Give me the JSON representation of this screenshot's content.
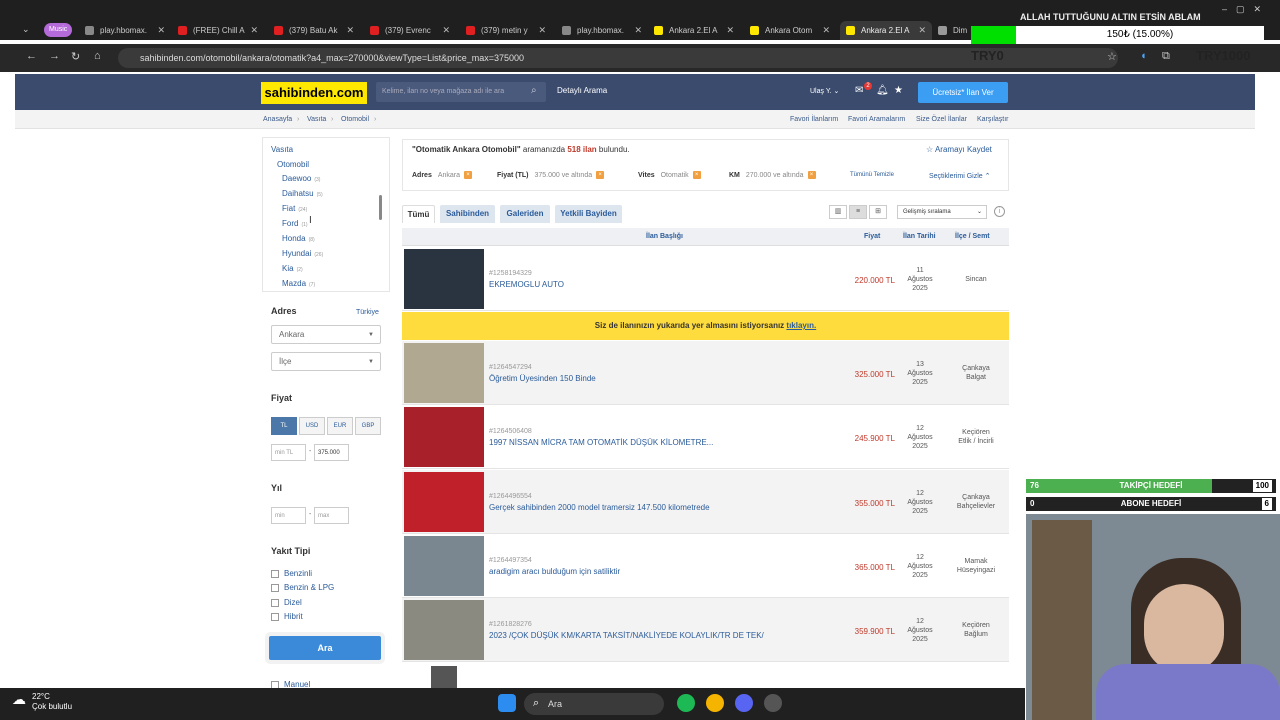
{
  "browser": {
    "tabs": [
      {
        "label": "play.hbomax.",
        "color": "#888"
      },
      {
        "label": "(FREE) Chill A",
        "color": "#e02020"
      },
      {
        "label": "(379) Batu Ak",
        "color": "#e02020"
      },
      {
        "label": "(379) Evrenc",
        "color": "#e02020"
      },
      {
        "label": "(379) metin y",
        "color": "#e02020"
      },
      {
        "label": "play.hbomax.",
        "color": "#888"
      },
      {
        "label": "Ankara 2.El A",
        "color": "#ffe800"
      },
      {
        "label": "Ankara Otom",
        "color": "#ffe800"
      },
      {
        "label": "Ankara 2.El A",
        "color": "#ffe800"
      },
      {
        "label": "Dim",
        "color": "#999"
      }
    ],
    "group_label": "Music",
    "url": "sahibinden.com/otomobil/ankara/otomatik?a4_max=270000&viewType=List&price_max=375000"
  },
  "site": {
    "logo": "sahibinden.com",
    "search_placeholder": "Kelime, ilan no veya mağaza adı ile ara",
    "detayli_arama": "Detaylı Arama",
    "user": "Ulaş Y.",
    "ilan_ver": "Ücretsiz* İlan Ver",
    "notif_count": "2"
  },
  "breadcrumb": [
    "Anasayfa",
    "Vasıta",
    "Otomobil"
  ],
  "top_links": [
    "Favori İlanlarım",
    "Favori Aramalarım",
    "Size Özel İlanlar",
    "Karşılaştır"
  ],
  "sidebar": {
    "root": "Vasıta",
    "sub": "Otomobil",
    "brands": [
      {
        "name": "Daewoo",
        "count": "(3)"
      },
      {
        "name": "Daihatsu",
        "count": "(5)"
      },
      {
        "name": "Fiat",
        "count": "(24)"
      },
      {
        "name": "Ford",
        "count": "(1)"
      },
      {
        "name": "Honda",
        "count": "(8)"
      },
      {
        "name": "Hyundai",
        "count": "(26)"
      },
      {
        "name": "Kia",
        "count": "(2)"
      },
      {
        "name": "Mazda",
        "count": "(7)"
      }
    ],
    "adres_title": "Adres",
    "adres_link": "Türkiye",
    "il": "Ankara",
    "ilce": "İlçe",
    "fiyat_title": "Fiyat",
    "currencies": [
      "TL",
      "USD",
      "EUR",
      "GBP"
    ],
    "price_min_ph": "min TL",
    "price_max": "375.000",
    "yil_title": "Yıl",
    "yil_min_ph": "min",
    "yil_max_ph": "max",
    "yakit_title": "Yakıt Tipi",
    "yakit": [
      "Benzinli",
      "Benzin & LPG",
      "Dizel",
      "Hibrit"
    ],
    "vites_partial": "Manuel",
    "ara": "Ara"
  },
  "results": {
    "query": "\"Otomatik Ankara Otomobil\"",
    "mid": " aramanızda ",
    "count": "518 ilan",
    "tail": " bulundu.",
    "save_search": "Aramayı Kaydet",
    "filters": [
      {
        "key": "Adres",
        "val": "Ankara"
      },
      {
        "key": "Fiyat (TL)",
        "val": "375.000 ve altında"
      },
      {
        "key": "Vites",
        "val": "Otomatik"
      },
      {
        "key": "KM",
        "val": "270.000 ve altında"
      }
    ],
    "clear_all": "Tümünü Temizle",
    "hide_selected": "Seçtiklerimi Gizle",
    "tabs": [
      "Tümü",
      "Sahibinden",
      "Galeriden",
      "Yetkili Bayiden"
    ],
    "sort": "Gelişmiş sıralama",
    "columns": [
      "İlan Başlığı",
      "Fiyat",
      "İlan Tarihi",
      "İlçe / Semt"
    ],
    "promo_text": "Siz de ilanınızın yukarıda yer almasını istiyorsanız ",
    "promo_link": "tıklayın.",
    "rows": [
      {
        "id": "#1258194329",
        "title": "EKREMOGLU AUTO",
        "price": "220.000 TL",
        "d1": "11",
        "d2": "Ağustos",
        "d3": "2025",
        "l1": "Sincan",
        "l2": ""
      },
      {
        "id": "#1264547294",
        "title": "Öğretim Üyesinden 150 Binde",
        "price": "325.000 TL",
        "d1": "13",
        "d2": "Ağustos",
        "d3": "2025",
        "l1": "Çankaya",
        "l2": "Balgat"
      },
      {
        "id": "#1264506408",
        "title": "1997 NİSSAN MİCRA TAM OTOMATİK DÜŞÜK KİLOMETRE...",
        "price": "245.900 TL",
        "d1": "12",
        "d2": "Ağustos",
        "d3": "2025",
        "l1": "Keçiören",
        "l2": "Etlik / İncirli"
      },
      {
        "id": "#1264496554",
        "title": "Gerçek sahibinden 2000 model tramersiz 147.500 kilometrede",
        "price": "355.000 TL",
        "d1": "12",
        "d2": "Ağustos",
        "d3": "2025",
        "l1": "Çankaya",
        "l2": "Bahçelievler"
      },
      {
        "id": "#1264497354",
        "title": "aradigim aracı bulduğum için satiliktir",
        "price": "365.000 TL",
        "d1": "12",
        "d2": "Ağustos",
        "d3": "2025",
        "l1": "Mamak",
        "l2": "Hüseyingazi"
      },
      {
        "id": "#1261828276",
        "title": "2023 /ÇOK DÜŞÜK KM/KARTA TAKSİT/NAKLİYEDE KOLAYLIK/TR DE TEK/",
        "price": "359.900 TL",
        "d1": "12",
        "d2": "Ağustos",
        "d3": "2025",
        "l1": "Keçiören",
        "l2": "Bağlum"
      }
    ]
  },
  "overlay": {
    "top_text": "ALLAH TUTTUĞUNU ALTIN ETSİN ABLAM",
    "donation_bar": "150₺ (15.00%)",
    "donation_fraction": 0.15,
    "try_min": "TRY0",
    "try_max": "TRY1000",
    "goal1_label": "TAKİPÇİ HEDEFİ",
    "goal1_current": "76",
    "goal1_target": "100",
    "goal1_fraction": 0.76,
    "goal2_label": "ABONE HEDEFİ",
    "goal2_current": "0",
    "goal2_target": "6"
  },
  "taskbar": {
    "temp": "22°C",
    "weather": "Çok bulutlu",
    "search": "Ara"
  }
}
